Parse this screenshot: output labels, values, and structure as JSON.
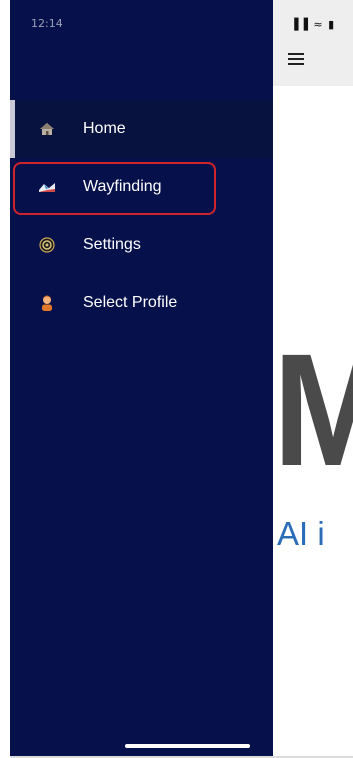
{
  "status_bar": {
    "time": "12:14",
    "icons": "▐▐ ≈ ▮"
  },
  "main": {
    "logo_letter": "M",
    "tagline": "AI i"
  },
  "drawer": {
    "items": [
      {
        "label": "Home",
        "icon": "home-icon",
        "active": true
      },
      {
        "label": "Wayfinding",
        "icon": "wayfinding-icon",
        "active": false,
        "highlighted": true
      },
      {
        "label": "Settings",
        "icon": "settings-icon",
        "active": false
      },
      {
        "label": "Select Profile",
        "icon": "profile-icon",
        "active": false
      }
    ]
  },
  "colors": {
    "drawer_bg": "#06104a",
    "highlight": "#d0242c",
    "tagline": "#2a6cb8"
  }
}
